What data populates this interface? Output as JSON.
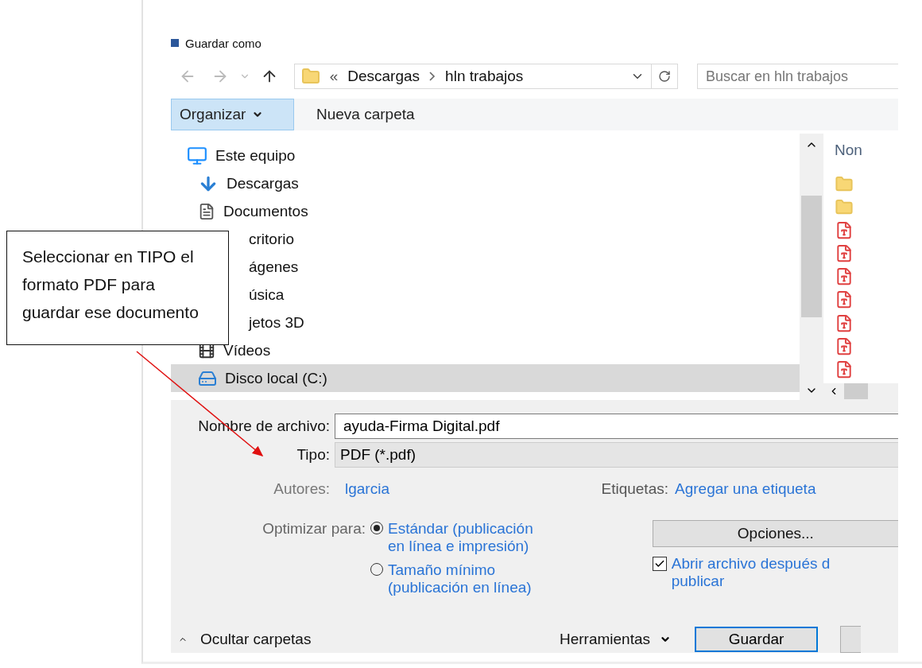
{
  "window": {
    "title": "Guardar como"
  },
  "address_bar": {
    "overflow": "«",
    "crumbs": [
      "Descargas",
      "hln trabajos"
    ],
    "search_placeholder": "Buscar en hln trabajos"
  },
  "toolbar": {
    "organize": "Organizar",
    "new_folder": "Nueva carpeta"
  },
  "nav_items": [
    {
      "label": "Este equipo",
      "kind": "pc",
      "selected": false
    },
    {
      "label": "Descargas",
      "kind": "download",
      "selected": false
    },
    {
      "label": "Documentos",
      "kind": "docs",
      "selected": false
    },
    {
      "label": "critorio",
      "kind": "covered",
      "selected": false
    },
    {
      "label": "ágenes",
      "kind": "covered",
      "selected": false
    },
    {
      "label": "úsica",
      "kind": "covered",
      "selected": false
    },
    {
      "label": "jetos 3D",
      "kind": "covered",
      "selected": false
    },
    {
      "label": "Vídeos",
      "kind": "video",
      "selected": false
    },
    {
      "label": "Disco local (C:)",
      "kind": "drive",
      "selected": true
    }
  ],
  "file_list": {
    "header": "Non",
    "files": [
      {
        "kind": "folder"
      },
      {
        "kind": "folder"
      },
      {
        "kind": "pdf"
      },
      {
        "kind": "pdf"
      },
      {
        "kind": "pdf"
      },
      {
        "kind": "pdf"
      },
      {
        "kind": "pdf"
      },
      {
        "kind": "pdf"
      },
      {
        "kind": "pdf"
      }
    ]
  },
  "form": {
    "filename_label": "Nombre de archivo:",
    "filename": "ayuda-Firma Digital.pdf",
    "type_label": "Tipo:",
    "type": "PDF (*.pdf)",
    "authors_label": "Autores:",
    "authors": "lgarcia",
    "tags_label": "Etiquetas:",
    "tags": "Agregar una etiqueta",
    "optimize_label": "Optimizar para:",
    "optimize_options": [
      {
        "lines": [
          "Estándar (publicación",
          "en línea e impresión)"
        ],
        "selected": true
      },
      {
        "lines": [
          "Tamaño mínimo",
          "(publicación en línea)"
        ],
        "selected": false
      }
    ],
    "options_button": "Opciones...",
    "open_after": {
      "lines": [
        "Abrir archivo después d",
        "publicar"
      ],
      "checked": true
    }
  },
  "footer": {
    "hide_folders": "Ocultar carpetas",
    "tools": "Herramientas",
    "save": "Guardar"
  },
  "callout": {
    "lines": [
      "Seleccionar en TIPO el",
      "formato PDF para",
      "guardar ese documento"
    ]
  }
}
